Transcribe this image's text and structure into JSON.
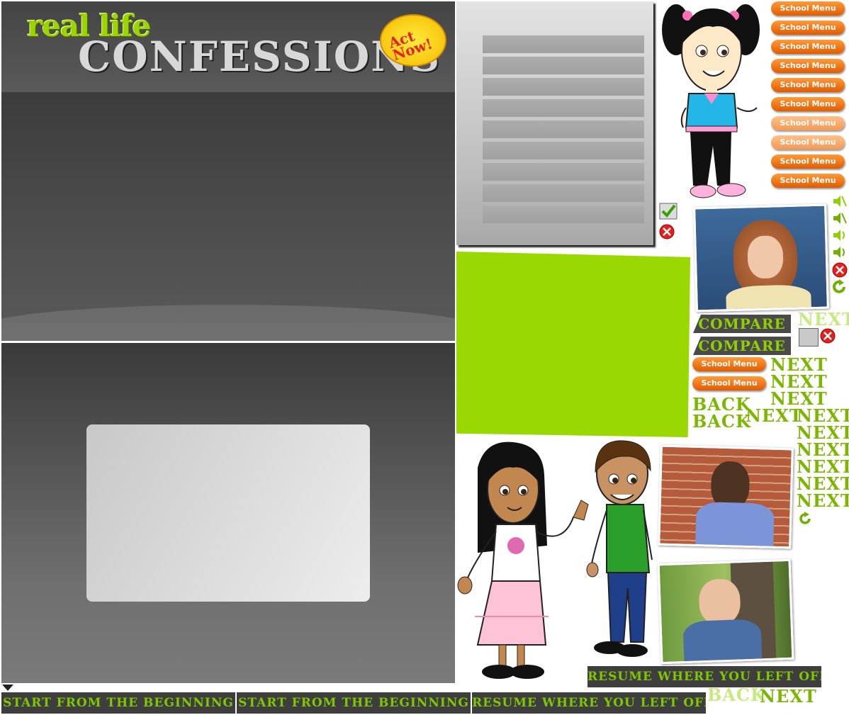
{
  "header": {
    "title_line1": "real life",
    "title_line2": "CONFESSIONS",
    "badge_text": "Act Now!"
  },
  "buttons": {
    "school_menu": "School Menu",
    "compare": "COMPARE",
    "next": "NEXT",
    "back": "BACK",
    "start": "START FROM THE BEGINNING",
    "resume": "RESUME WHERE YOU LEFT OFF"
  },
  "colors": {
    "accent_green": "#99d800",
    "button_orange": "#f07010",
    "panel_dark": "#3a3a3a"
  },
  "icons": [
    "check-icon",
    "close-icon",
    "mute-icon",
    "speaker-icon",
    "replay-icon",
    "triangle-down-icon"
  ]
}
